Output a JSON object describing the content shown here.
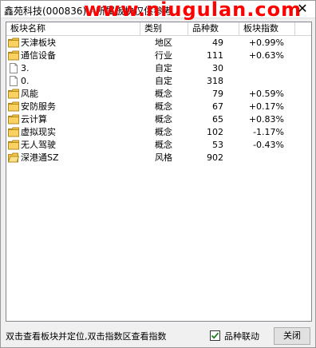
{
  "window": {
    "title": "鑫苑科技(000836) - 所属板块仅供参考",
    "watermark": "www.niugulan.com"
  },
  "table": {
    "columns": [
      "板块名称",
      "类别",
      "品种数",
      "板块指数"
    ],
    "rows": [
      {
        "icon": "folder-icon",
        "name": "天津板块",
        "category": "地区",
        "count": "49",
        "index": "+0.99%"
      },
      {
        "icon": "folder-icon",
        "name": "通信设备",
        "category": "行业",
        "count": "111",
        "index": "+0.63%"
      },
      {
        "icon": "document-icon",
        "name": "3.",
        "category": "自定",
        "count": "30",
        "index": ""
      },
      {
        "icon": "document-icon",
        "name": "0.",
        "category": "自定",
        "count": "318",
        "index": ""
      },
      {
        "icon": "folder-icon",
        "name": "风能",
        "category": "概念",
        "count": "79",
        "index": "+0.59%"
      },
      {
        "icon": "folder-icon",
        "name": "安防服务",
        "category": "概念",
        "count": "67",
        "index": "+0.17%"
      },
      {
        "icon": "folder-icon",
        "name": "云计算",
        "category": "概念",
        "count": "65",
        "index": "+0.83%"
      },
      {
        "icon": "folder-icon",
        "name": "虚拟现实",
        "category": "概念",
        "count": "102",
        "index": "-1.17%"
      },
      {
        "icon": "folder-icon",
        "name": "无人驾驶",
        "category": "概念",
        "count": "53",
        "index": "-0.43%"
      },
      {
        "icon": "folder-open-icon",
        "name": "深港通SZ",
        "category": "风格",
        "count": "902",
        "index": ""
      }
    ]
  },
  "status": {
    "hint": "双击查看板块并定位,双击指数区查看指数",
    "checkbox_label": "品种联动",
    "checkbox_checked": true,
    "close_button": "关闭"
  },
  "colors": {
    "folder": "#f5c542",
    "watermark": "#ff0000",
    "check": "#1a7f1a"
  }
}
